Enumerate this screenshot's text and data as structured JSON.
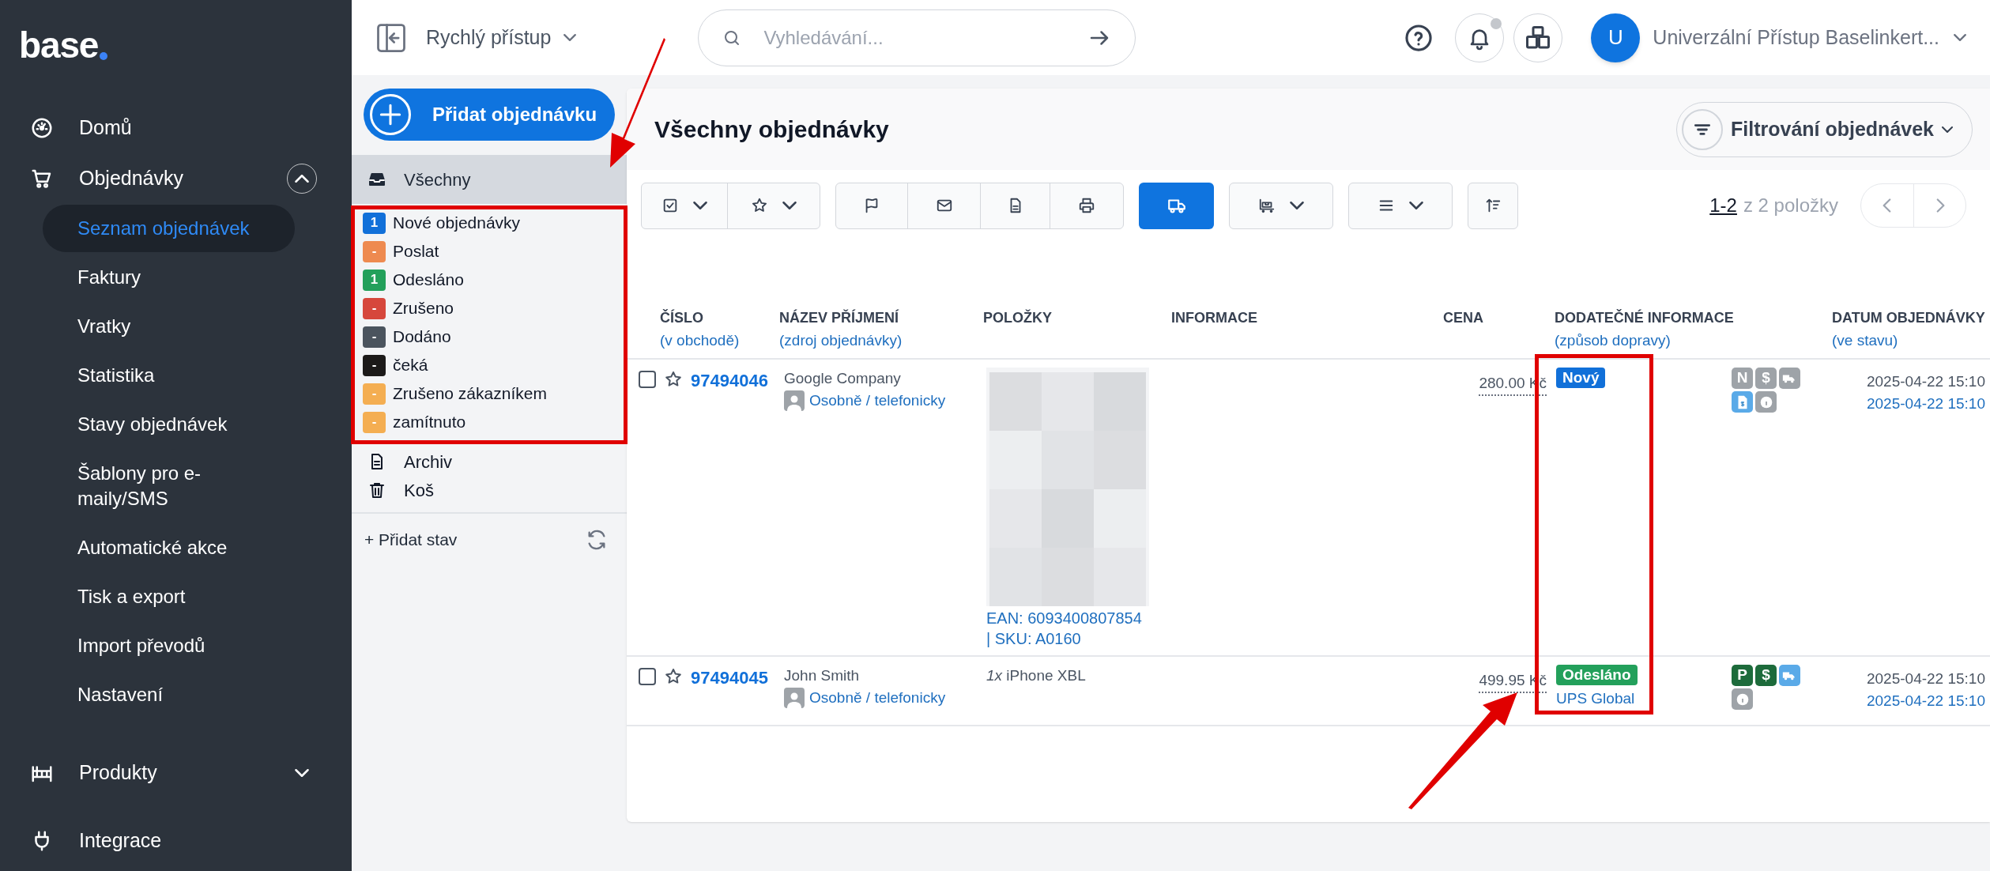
{
  "logo": "base",
  "nav": [
    {
      "label": "Domů"
    },
    {
      "label": "Objednávky",
      "expanded": true,
      "children": [
        {
          "label": "Seznam objednávek",
          "selected": true
        },
        {
          "label": "Faktury",
          "selected": false
        },
        {
          "label": "Vratky",
          "selected": false
        },
        {
          "label": "Statistika",
          "selected": false
        },
        {
          "label": "Stavy objednávek",
          "selected": false
        },
        {
          "label": "Šablony pro e-maily/SMS",
          "selected": false
        },
        {
          "label": "Automatické akce",
          "selected": false
        },
        {
          "label": "Tisk a export",
          "selected": false
        },
        {
          "label": "Import převodů",
          "selected": false
        },
        {
          "label": "Nastavení",
          "selected": false
        }
      ]
    },
    {
      "label": "Produkty",
      "expanded": false
    },
    {
      "label": "Integrace"
    }
  ],
  "topbar": {
    "quick_access": "Rychlý přístup",
    "search": {
      "placeholder": "Vyhledávání..."
    },
    "avatar": "U",
    "user": "Univerzální Přístup Baselinkert..."
  },
  "status_panel": {
    "add_button": "Přidat objednávku",
    "all": {
      "label": "Všechny",
      "selected": true
    },
    "statuses": [
      {
        "count": "1",
        "label": "Nové objednávky",
        "color": "#1170d9"
      },
      {
        "count": "-",
        "label": "Poslat",
        "color": "#ee8a50"
      },
      {
        "count": "1",
        "label": "Odesláno",
        "color": "#23a05b"
      },
      {
        "count": "-",
        "label": "Zrušeno",
        "color": "#d6473c"
      },
      {
        "count": "-",
        "label": "Dodáno",
        "color": "#4b545e"
      },
      {
        "count": "-",
        "label": "čeká",
        "color": "#1c1a19"
      },
      {
        "count": "-",
        "label": "Zrušeno zákazníkem",
        "color": "#f4ae52"
      },
      {
        "count": "-",
        "label": "zamítnuto",
        "color": "#f4ae52"
      }
    ],
    "folders": [
      "Archiv",
      "Koš"
    ],
    "add_status": "+ Přidat stav"
  },
  "main": {
    "title": "Všechny objednávky",
    "filter_button": "Filtrování objednávek",
    "pagination": {
      "range": "1-2",
      "total": "z 2 položky"
    },
    "columns": [
      {
        "title": "ČÍSLO",
        "subtitle": "(v obchodě)"
      },
      {
        "title": "NÁZEV PŘÍJMENÍ",
        "subtitle": "(zdroj objednávky)"
      },
      {
        "title": "POLOŽKY"
      },
      {
        "title": "INFORMACE"
      },
      {
        "title": "CENA"
      },
      {
        "title": "DODATEČNÉ INFORMACE",
        "subtitle": "(způsob dopravy)"
      },
      {
        "title": "DATUM OBJEDNÁVKY",
        "subtitle": "(ve stavu)"
      }
    ],
    "rows": [
      {
        "checked": false,
        "starred": false,
        "number": "97494046",
        "name": "Google Company",
        "source": "Osobně / telefonicky",
        "items": {
          "kind": "picture",
          "text": "EAN: 6093400807854 | SKU: A0160"
        },
        "price": "280.00 Kč",
        "status": {
          "label": "Nový",
          "color": "#1170d9"
        },
        "badges": [
          {
            "kind": "letter",
            "text": "N",
            "color": "#9ea3a8"
          },
          {
            "kind": "letter",
            "text": "$",
            "color": "#9ea3a8"
          },
          {
            "kind": "truck",
            "color": "#9ea3a8"
          },
          {
            "kind": "invoice",
            "color": "#5aaae8"
          },
          {
            "kind": "info",
            "color": "#9ea3a8"
          }
        ],
        "date": "2025-04-22 15:10",
        "status_date": "2025-04-22 15:10"
      },
      {
        "checked": false,
        "starred": false,
        "number": "97494045",
        "name": "John Smith",
        "source": "Osobně / telefonicky",
        "items": {
          "kind": "text",
          "text": "*1x* iPhone XBL"
        },
        "price": "499.95 Kč",
        "status": {
          "label": "Odesláno",
          "color": "#23a05b"
        },
        "shipping": "UPS Global",
        "badges": [
          {
            "kind": "letter",
            "text": "P",
            "color": "#1d6b3b"
          },
          {
            "kind": "letter",
            "text": "$",
            "color": "#1d6b3b"
          },
          {
            "kind": "truck",
            "color": "#5aaae8"
          },
          {
            "kind": "info",
            "color": "#9ea3a8"
          }
        ],
        "date": "2025-04-22 15:10",
        "status_date": "2025-04-22 15:10"
      }
    ]
  }
}
